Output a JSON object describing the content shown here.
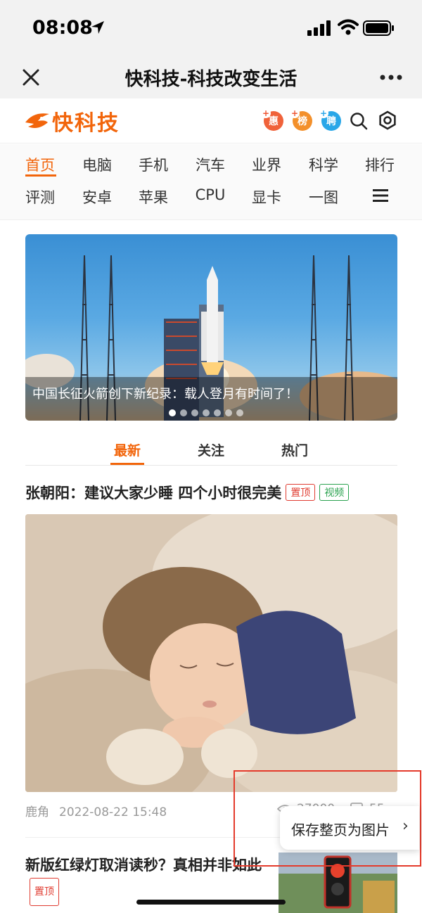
{
  "status_bar": {
    "time": "08:08"
  },
  "nav_bar": {
    "title": "快科技-科技改变生活"
  },
  "site_header": {
    "logo_text": "快科技",
    "badges": [
      "惠",
      "榜",
      "聘"
    ],
    "brand_color": "#f2650b"
  },
  "categories": {
    "row1": [
      "首页",
      "电脑",
      "手机",
      "汽车",
      "业界",
      "科学",
      "排行"
    ],
    "row2": [
      "评测",
      "安卓",
      "苹果",
      "CPU",
      "显卡",
      "一图"
    ],
    "active": "首页"
  },
  "banner": {
    "caption": "中国长征火箭创下新纪录：载人登月有时间了！",
    "slide_count": 7,
    "active_slide": 1
  },
  "feed_tabs": {
    "items": [
      "最新",
      "关注",
      "热门"
    ],
    "active": "最新"
  },
  "articles": [
    {
      "title": "张朝阳：建议大家少睡 四个小时很完美",
      "tags": [
        "置顶",
        "视频"
      ],
      "author": "鹿角",
      "date": "2022-08-22 15:48",
      "views": "27000",
      "comments": "55"
    },
    {
      "title": "新版红绿灯取消读秒？真相并非如此",
      "tags": [
        "置顶"
      ]
    }
  ],
  "overlay": {
    "save_label": "保存整页为图片",
    "chevron": "›"
  }
}
